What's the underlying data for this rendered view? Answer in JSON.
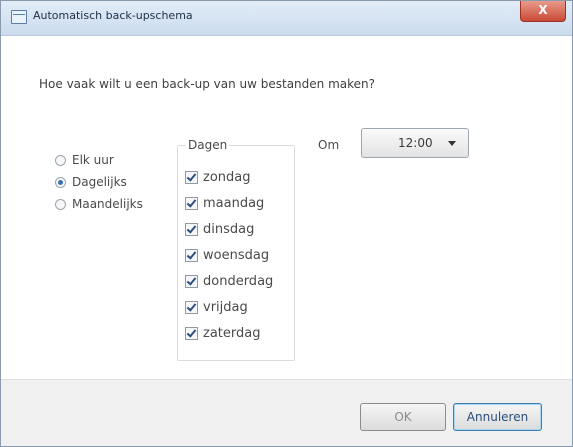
{
  "window": {
    "title": "Automatisch back-upschema",
    "close_label": "X"
  },
  "question": "Hoe vaak wilt u een back-up van uw bestanden maken?",
  "frequency": {
    "options": [
      {
        "label": "Elk uur",
        "checked": false
      },
      {
        "label": "Dagelijks",
        "checked": true
      },
      {
        "label": "Maandelijks",
        "checked": false
      }
    ]
  },
  "days": {
    "legend": "Dagen",
    "items": [
      {
        "label": "zondag",
        "checked": true
      },
      {
        "label": "maandag",
        "checked": true
      },
      {
        "label": "dinsdag",
        "checked": true
      },
      {
        "label": "woensdag",
        "checked": true
      },
      {
        "label": "donderdag",
        "checked": true
      },
      {
        "label": "vrijdag",
        "checked": true
      },
      {
        "label": "zaterdag",
        "checked": true
      }
    ]
  },
  "time": {
    "label": "Om",
    "value": "12:00"
  },
  "buttons": {
    "ok": "OK",
    "cancel": "Annuleren"
  }
}
